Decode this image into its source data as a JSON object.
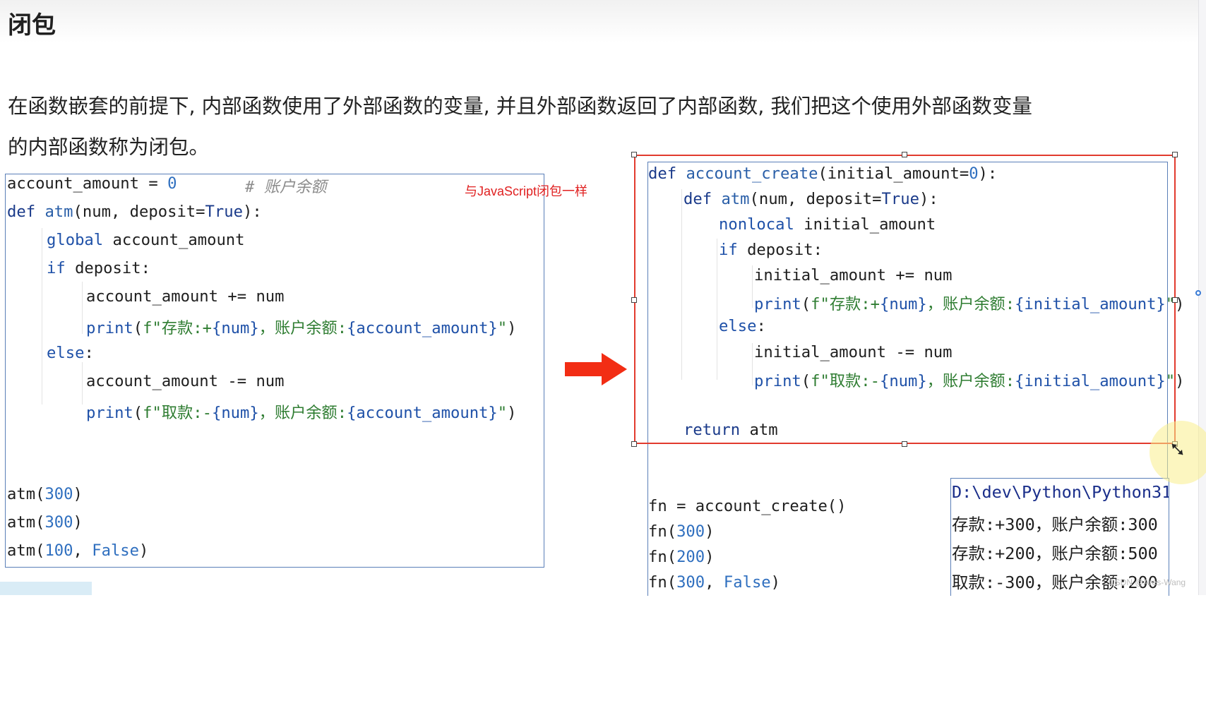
{
  "heading": "闭包",
  "paragraph": {
    "line1": "在函数嵌套的前提下, 内部函数使用了外部函数的变量, 并且外部函数返回了内部函数, 我们把这个使用外部函数变量",
    "line2": "的内部函数称为闭包。"
  },
  "annotation_note": "与JavaScript闭包一样",
  "left_code": {
    "l1_a": "account_amount = ",
    "l1_num": "0",
    "l1_comment": "# 账户余额",
    "l2_kw": "def ",
    "l2_fn": "atm",
    "l2_a": "(num, deposit=",
    "l2_true": "True",
    "l2_b": "):",
    "l3_kw": "global",
    "l3_a": " account_amount",
    "l4_kw": "if",
    "l4_a": " deposit:",
    "l5": "account_amount += num",
    "l6_fn": "print",
    "l6_a": "(",
    "l6_str1": "f\"存款:+",
    "l6_var1": "{num}",
    "l6_str2": "，账户余额:",
    "l6_var2": "{account_amount}",
    "l6_str3": "\"",
    "l6_b": ")",
    "l7_kw": "else",
    "l7_a": ":",
    "l8": "account_amount -= num",
    "l9_fn": "print",
    "l9_a": "(",
    "l9_str1": "f\"取款:-",
    "l9_var1": "{num}",
    "l9_str2": "，账户余额:",
    "l9_var2": "{account_amount}",
    "l9_str3": "\"",
    "l9_b": ")",
    "c1_a": "atm(",
    "c1_num": "300",
    "c1_b": ")",
    "c2_a": "atm(",
    "c2_num": "300",
    "c2_b": ")",
    "c3_a": "atm(",
    "c3_num": "100",
    "c3_sep": ", ",
    "c3_false": "False",
    "c3_b": ")"
  },
  "right_code": {
    "r1_kw": "def ",
    "r1_fn": "account_create",
    "r1_a": "(initial_amount=",
    "r1_num": "0",
    "r1_b": "):",
    "r2_kw": "def ",
    "r2_fn": "atm",
    "r2_a": "(num, deposit=",
    "r2_true": "True",
    "r2_b": "):",
    "r3_kw": "nonlocal",
    "r3_a": " initial_amount",
    "r4_kw": "if",
    "r4_a": " deposit:",
    "r5": "initial_amount += num",
    "r6_fn": "print",
    "r6_a": "(",
    "r6_str1": "f\"存款:+",
    "r6_var1": "{num}",
    "r6_str2": "，账户余额:",
    "r6_var2": "{initial_amount}",
    "r6_str3": "\"",
    "r6_b": ")",
    "r7_kw": "else",
    "r7_a": ":",
    "r8": "initial_amount -= num",
    "r9_fn": "print",
    "r9_a": "(",
    "r9_str1": "f\"取款:-",
    "r9_var1": "{num}",
    "r9_str2": "，账户余额:",
    "r9_var2": "{initial_amount}",
    "r9_str3": "\"",
    "r9_b": ")",
    "r10_kw": "return",
    "r10_a": " atm",
    "c1": "fn = account_create()",
    "c2_a": "fn(",
    "c2_num": "300",
    "c2_b": ")",
    "c3_a": "fn(",
    "c3_num": "200",
    "c3_b": ")",
    "c4_a": "fn(",
    "c4_num": "300",
    "c4_sep": ", ",
    "c4_false": "False",
    "c4_b": ")"
  },
  "output": {
    "path": "D:\\dev\\Python\\Python31",
    "line1": "存款:+300，账户余额:300",
    "line2": "存款:+200，账户余额:500",
    "line3": "取款:-300，账户余额:200"
  },
  "watermark": "CSDN @Ares-Wang",
  "colors": {
    "keyword": "#1a3a8a",
    "string": "#2f7d32",
    "number": "#2f6fbf",
    "selection": "#e23b2e",
    "arrow": "#f22d14"
  }
}
